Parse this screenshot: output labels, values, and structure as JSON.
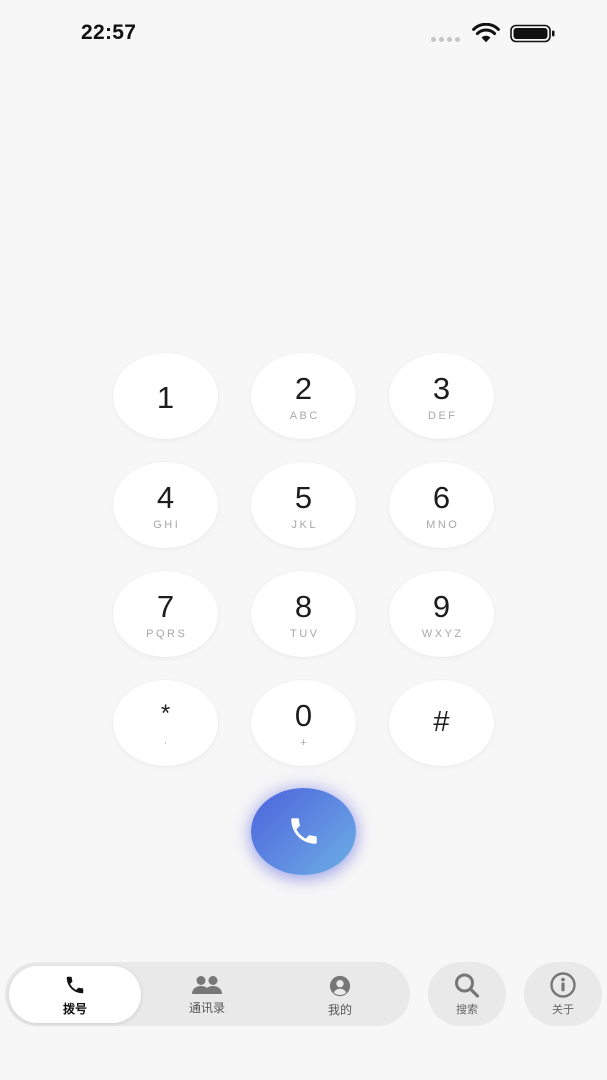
{
  "status_bar": {
    "time": "22:57",
    "signal_icon": "signal-dots-icon",
    "wifi_icon": "wifi-icon",
    "battery_icon": "battery-icon"
  },
  "keypad": {
    "keys": [
      {
        "digit": "1",
        "letters": ""
      },
      {
        "digit": "2",
        "letters": "ABC"
      },
      {
        "digit": "3",
        "letters": "DEF"
      },
      {
        "digit": "4",
        "letters": "GHI"
      },
      {
        "digit": "5",
        "letters": "JKL"
      },
      {
        "digit": "6",
        "letters": "MNO"
      },
      {
        "digit": "7",
        "letters": "PQRS"
      },
      {
        "digit": "8",
        "letters": "TUV"
      },
      {
        "digit": "9",
        "letters": "WXYZ"
      },
      {
        "digit": "*",
        "letters": "·"
      },
      {
        "digit": "0",
        "letters": "+"
      },
      {
        "digit": "#",
        "letters": ""
      }
    ]
  },
  "call_button": {
    "icon": "phone-icon",
    "colors": {
      "gradient_start": "#4b64dc",
      "gradient_end": "#6bb0e4",
      "glow": "#5a5ae6"
    }
  },
  "tabbar": {
    "tabs": [
      {
        "label": "拨号",
        "icon": "phone-icon",
        "active": true
      },
      {
        "label": "通讯录",
        "icon": "people-icon",
        "active": false
      },
      {
        "label": "我的",
        "icon": "user-circle-icon",
        "active": false
      }
    ],
    "search": {
      "label": "搜索",
      "icon": "search-icon"
    },
    "about": {
      "label": "关于",
      "icon": "info-icon"
    }
  }
}
